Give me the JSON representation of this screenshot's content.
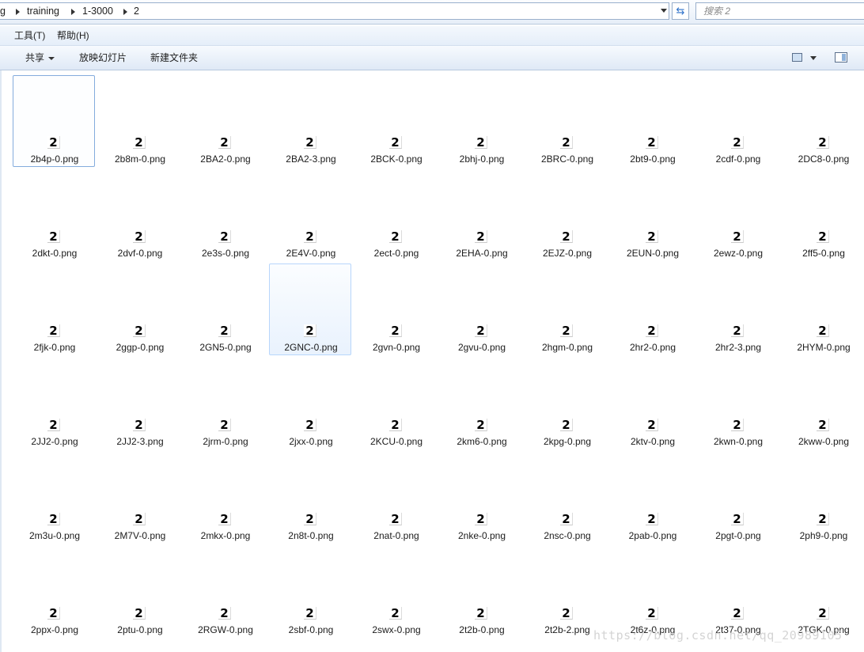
{
  "address_bar": {
    "crumbs": [
      "g",
      "training",
      "1-3000",
      "2"
    ],
    "refresh_icon": "refresh-icon"
  },
  "search": {
    "placeholder": "搜索 2"
  },
  "menu": {
    "tools": "工具(T)",
    "help": "帮助(H)"
  },
  "commands": {
    "share": "共享",
    "slideshow": "放映幻灯片",
    "new_folder": "新建文件夹"
  },
  "thumbnail_glyph": "2",
  "files": [
    "2b4p-0.png",
    "2b8m-0.png",
    "2BA2-0.png",
    "2BA2-3.png",
    "2BCK-0.png",
    "2bhj-0.png",
    "2BRC-0.png",
    "2bt9-0.png",
    "2cdf-0.png",
    "2DC8-0.png",
    "2dkt-0.png",
    "2dvf-0.png",
    "2e3s-0.png",
    "2E4V-0.png",
    "2ect-0.png",
    "2EHA-0.png",
    "2EJZ-0.png",
    "2EUN-0.png",
    "2ewz-0.png",
    "2ff5-0.png",
    "2fjk-0.png",
    "2ggp-0.png",
    "2GN5-0.png",
    "2GNC-0.png",
    "2gvn-0.png",
    "2gvu-0.png",
    "2hgm-0.png",
    "2hr2-0.png",
    "2hr2-3.png",
    "2HYM-0.png",
    "2JJ2-0.png",
    "2JJ2-3.png",
    "2jrm-0.png",
    "2jxx-0.png",
    "2KCU-0.png",
    "2km6-0.png",
    "2kpg-0.png",
    "2ktv-0.png",
    "2kwn-0.png",
    "2kww-0.png",
    "2m3u-0.png",
    "2M7V-0.png",
    "2mkx-0.png",
    "2n8t-0.png",
    "2nat-0.png",
    "2nke-0.png",
    "2nsc-0.png",
    "2pab-0.png",
    "2pgt-0.png",
    "2ph9-0.png",
    "2ppx-0.png",
    "2ptu-0.png",
    "2RGW-0.png",
    "2sbf-0.png",
    "2swx-0.png",
    "2t2b-0.png",
    "2t2b-2.png",
    "2t6z-0.png",
    "2t37-0.png",
    "2TGK-0.png"
  ],
  "selected_file": "2b4p-0.png",
  "hovered_file": "2GNC-0.png",
  "watermark": "https://blog.csdn.net/qq_20989105"
}
